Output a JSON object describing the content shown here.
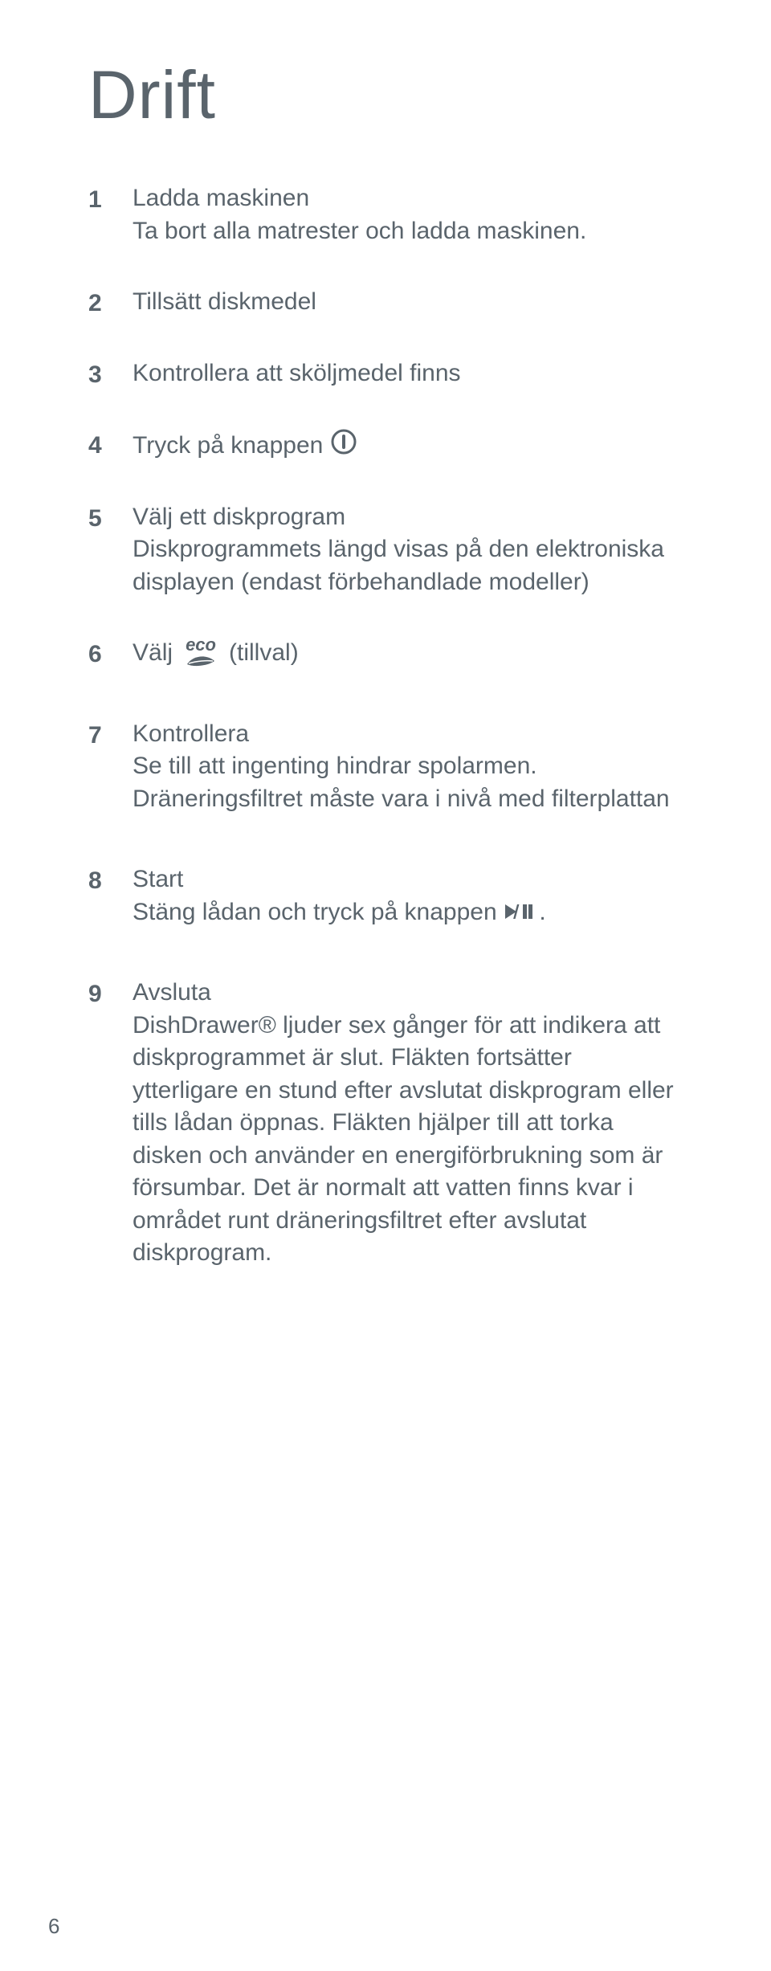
{
  "title": "Drift",
  "steps": [
    {
      "num": "1",
      "heading": "Ladda maskinen",
      "body": "Ta bort alla matrester och ladda maskinen."
    },
    {
      "num": "2",
      "heading": "Tillsätt diskmedel",
      "body": ""
    },
    {
      "num": "3",
      "heading": "Kontrollera att sköljmedel finns",
      "body": ""
    },
    {
      "num": "4",
      "heading_prefix": "Tryck på knappen",
      "body": ""
    },
    {
      "num": "5",
      "heading": "Välj ett diskprogram",
      "body": "Diskprogrammets längd visas på den elektroniska displayen (endast förbehandlade modeller)"
    },
    {
      "num": "6",
      "heading_prefix": "Välj",
      "eco_label": "eco",
      "tillval": "(tillval)",
      "body": ""
    },
    {
      "num": "7",
      "heading": "Kontrollera",
      "body": "Se till att ingenting hindrar spolarmen. Dräneringsfiltret måste vara i nivå med filterplattan"
    },
    {
      "num": "8",
      "heading": "Start",
      "body_prefix": "Stäng lådan och tryck på knappen",
      "body_suffix": "."
    },
    {
      "num": "9",
      "heading": "Avsluta",
      "body": "DishDrawer® ljuder sex gånger för att indikera att diskprogrammet är slut. Fläkten fortsätter ytterligare en stund efter avslutat diskprogram eller tills lådan öppnas. Fläkten hjälper till att torka disken och använder en energiförbrukning som är försumbar. Det är normalt att vatten finns kvar i området runt dräneringsfiltret efter avslutat diskprogram."
    }
  ],
  "page_number": "6"
}
